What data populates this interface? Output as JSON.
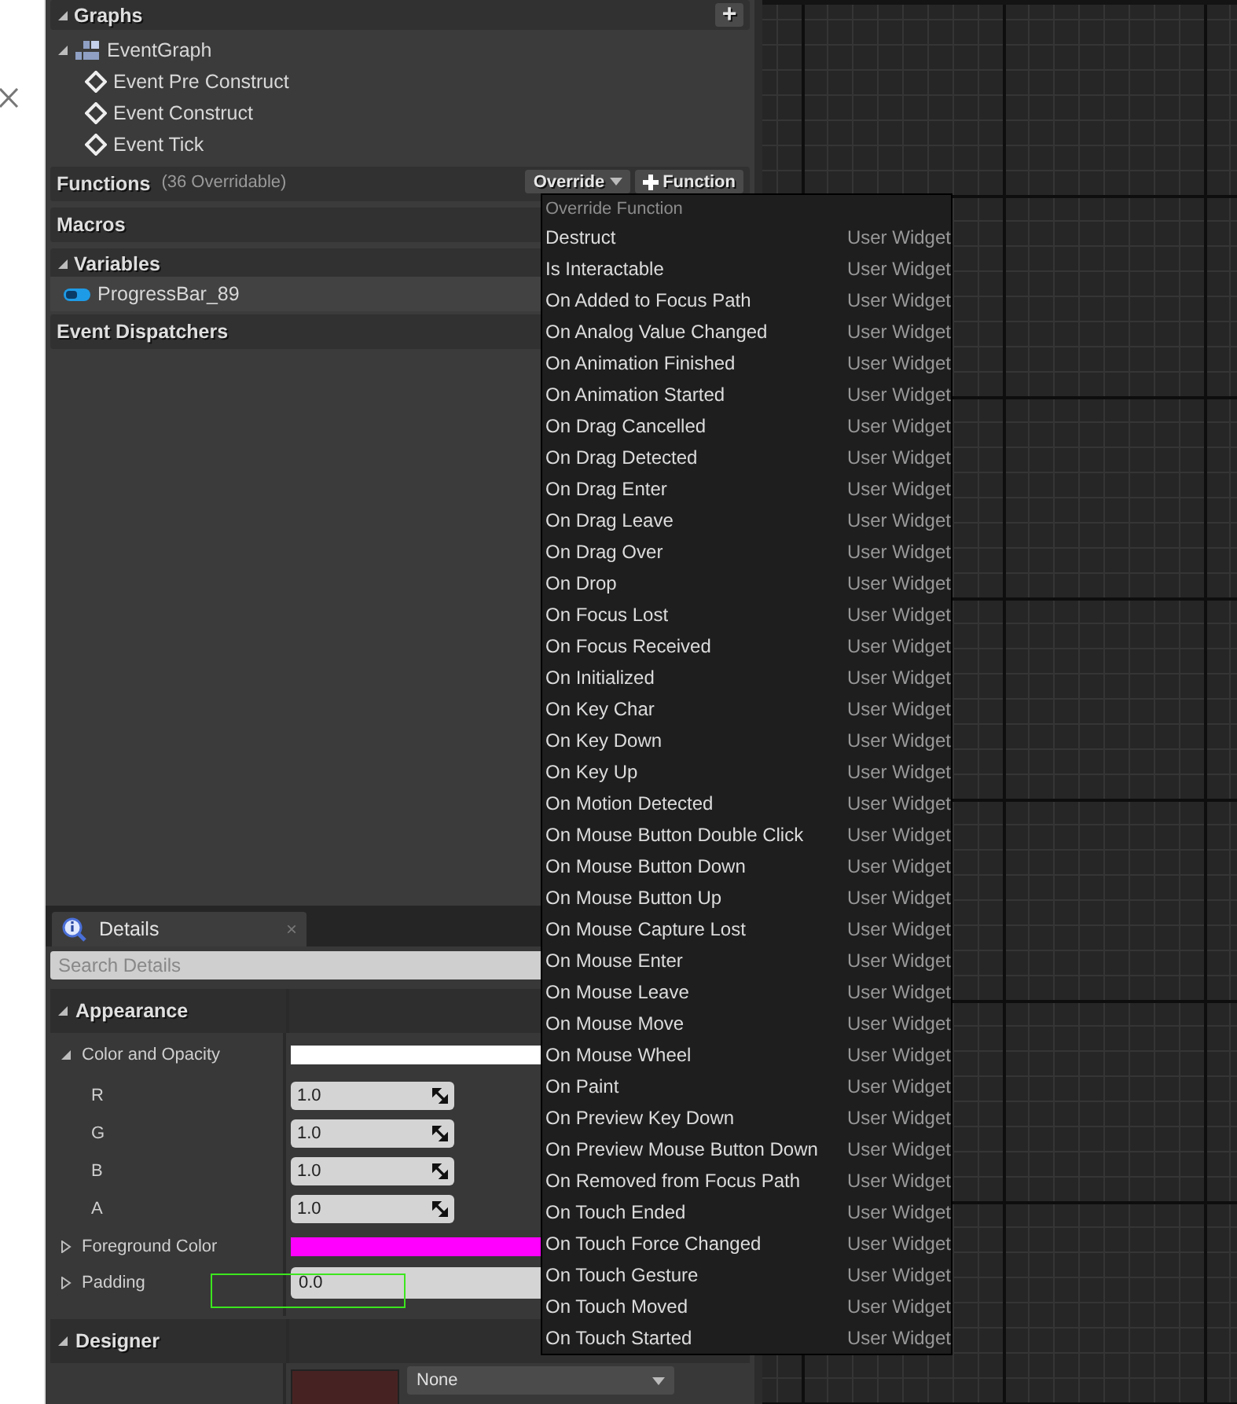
{
  "graphs": {
    "title": "Graphs",
    "expanded": true,
    "add_button": "+",
    "tree": [
      {
        "label": "EventGraph",
        "expanded": true,
        "children": [
          {
            "label": "Event Pre Construct"
          },
          {
            "label": "Event Construct"
          },
          {
            "label": "Event Tick"
          }
        ]
      }
    ]
  },
  "functions": {
    "title": "Functions",
    "note": "(36 Overridable)",
    "override_button": "Override",
    "add_button": "Function"
  },
  "macros": {
    "title": "Macros"
  },
  "variables": {
    "title": "Variables",
    "expanded": true,
    "items": [
      {
        "name": "ProgressBar_89"
      }
    ]
  },
  "event_dispatchers": {
    "title": "Event Dispatchers"
  },
  "details": {
    "tab": "Details",
    "tab_close": "×",
    "search_placeholder": "Search Details",
    "categories": [
      {
        "title": "Appearance",
        "expanded": true,
        "properties": [
          {
            "kind": "color",
            "label": "Color and Opacity",
            "expanded": true,
            "color": "#ffffff",
            "children": [
              {
                "label": "R",
                "value": "1.0"
              },
              {
                "label": "G",
                "value": "1.0"
              },
              {
                "label": "B",
                "value": "1.0"
              },
              {
                "label": "A",
                "value": "1.0"
              }
            ]
          },
          {
            "kind": "color",
            "label": "Foreground Color",
            "expanded": false,
            "color": "#ff00ff"
          },
          {
            "kind": "text",
            "label": "Padding",
            "expanded": false,
            "value": "0.0"
          }
        ]
      },
      {
        "title": "Designer",
        "expanded": true,
        "properties": [
          {
            "kind": "brush",
            "color": "#472222",
            "value": "None"
          }
        ]
      }
    ]
  },
  "override_menu": {
    "heading": "Override Function",
    "items": [
      {
        "name": "Destruct",
        "source": "User Widget"
      },
      {
        "name": "Is Interactable",
        "source": "User Widget"
      },
      {
        "name": "On Added to Focus Path",
        "source": "User Widget"
      },
      {
        "name": "On Analog Value Changed",
        "source": "User Widget"
      },
      {
        "name": "On Animation Finished",
        "source": "User Widget"
      },
      {
        "name": "On Animation Started",
        "source": "User Widget"
      },
      {
        "name": "On Drag Cancelled",
        "source": "User Widget"
      },
      {
        "name": "On Drag Detected",
        "source": "User Widget"
      },
      {
        "name": "On Drag Enter",
        "source": "User Widget"
      },
      {
        "name": "On Drag Leave",
        "source": "User Widget"
      },
      {
        "name": "On Drag Over",
        "source": "User Widget"
      },
      {
        "name": "On Drop",
        "source": "User Widget"
      },
      {
        "name": "On Focus Lost",
        "source": "User Widget"
      },
      {
        "name": "On Focus Received",
        "source": "User Widget"
      },
      {
        "name": "On Initialized",
        "source": "User Widget"
      },
      {
        "name": "On Key Char",
        "source": "User Widget"
      },
      {
        "name": "On Key Down",
        "source": "User Widget"
      },
      {
        "name": "On Key Up",
        "source": "User Widget"
      },
      {
        "name": "On Motion Detected",
        "source": "User Widget"
      },
      {
        "name": "On Mouse Button Double Click",
        "source": "User Widget"
      },
      {
        "name": "On Mouse Button Down",
        "source": "User Widget"
      },
      {
        "name": "On Mouse Button Up",
        "source": "User Widget"
      },
      {
        "name": "On Mouse Capture Lost",
        "source": "User Widget"
      },
      {
        "name": "On Mouse Enter",
        "source": "User Widget"
      },
      {
        "name": "On Mouse Leave",
        "source": "User Widget"
      },
      {
        "name": "On Mouse Move",
        "source": "User Widget"
      },
      {
        "name": "On Mouse Wheel",
        "source": "User Widget"
      },
      {
        "name": "On Paint",
        "source": "User Widget"
      },
      {
        "name": "On Preview Key Down",
        "source": "User Widget"
      },
      {
        "name": "On Preview Mouse Button Down",
        "source": "User Widget"
      },
      {
        "name": "On Removed from Focus Path",
        "source": "User Widget"
      },
      {
        "name": "On Touch Ended",
        "source": "User Widget"
      },
      {
        "name": "On Touch Force Changed",
        "source": "User Widget"
      },
      {
        "name": "On Touch Gesture",
        "source": "User Widget"
      },
      {
        "name": "On Touch Moved",
        "source": "User Widget"
      },
      {
        "name": "On Touch Started",
        "source": "User Widget"
      }
    ]
  }
}
